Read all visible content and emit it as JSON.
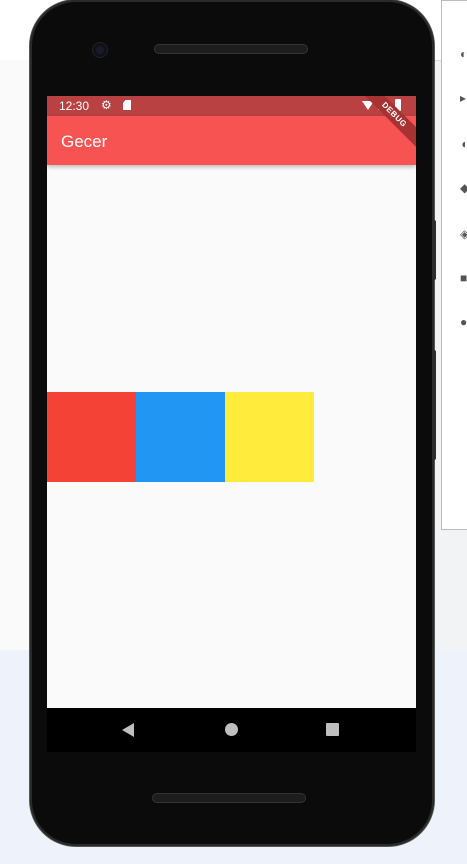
{
  "app": {
    "title": "Gecer",
    "debug_banner": "DEBUG"
  },
  "status_bar": {
    "time": "12:30",
    "icons": [
      "settings-icon",
      "sd-card-icon",
      "wifi-icon",
      "signal-icon",
      "battery-icon"
    ]
  },
  "boxes": [
    {
      "color": "#f44336"
    },
    {
      "color": "#2196f3"
    },
    {
      "color": "#ffeb3b"
    }
  ],
  "navigation": {
    "buttons": [
      "back-icon",
      "home-icon",
      "recents-icon"
    ]
  },
  "colors": {
    "app_bar": "#f75353",
    "status_bar": "#b94141",
    "screen_background": "#fafafa"
  }
}
